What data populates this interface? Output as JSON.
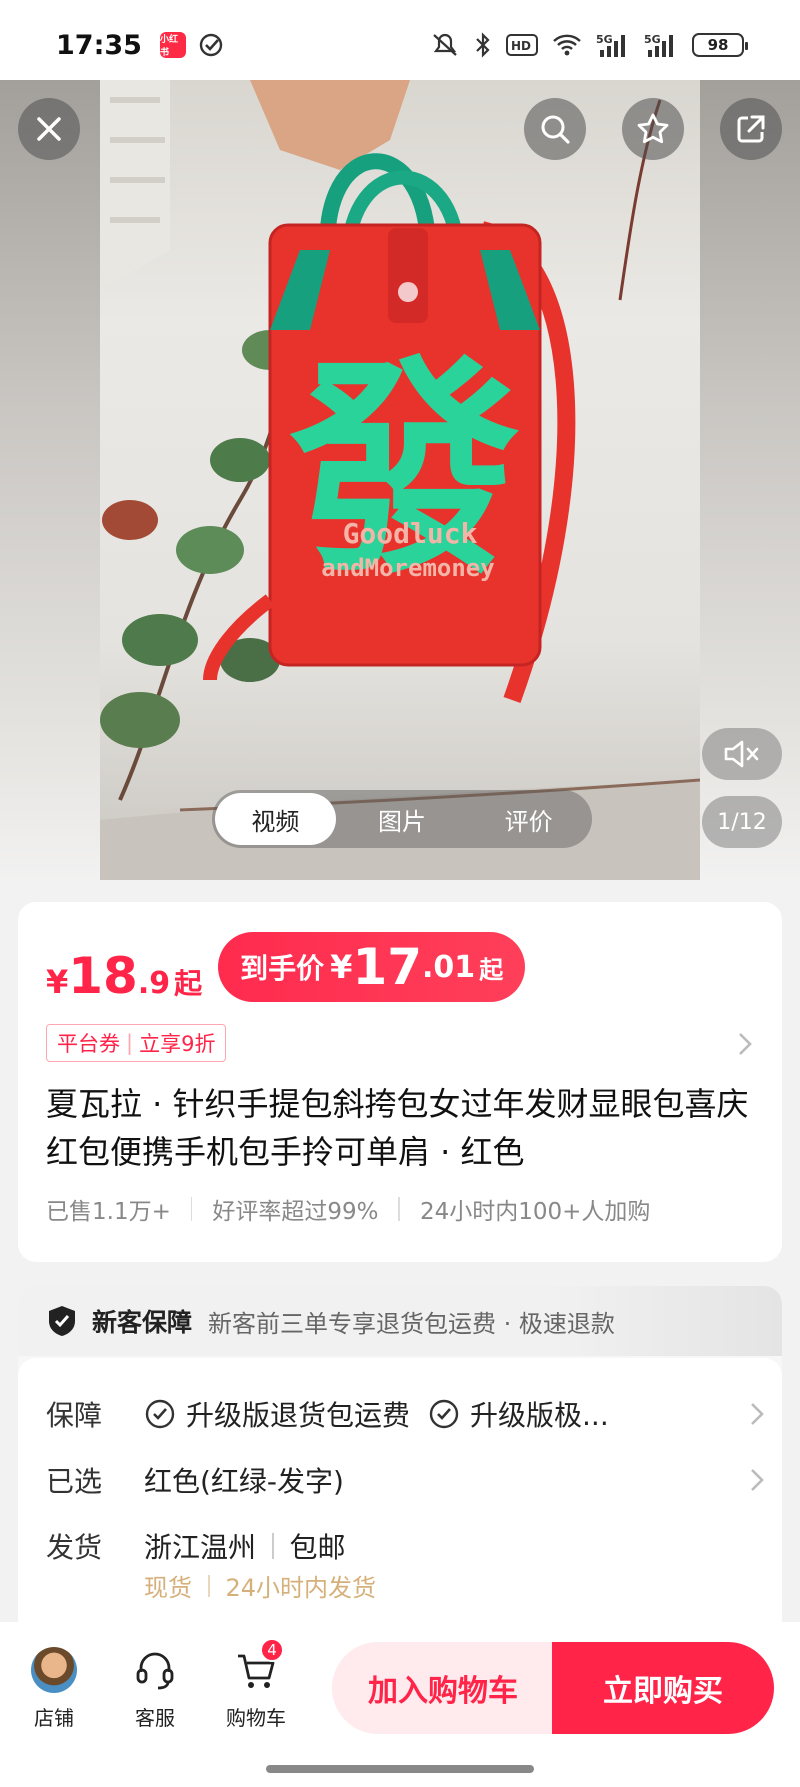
{
  "status_bar": {
    "time": "17:35",
    "app_badge": "小红书",
    "battery": "98",
    "icons": [
      "mute-icon",
      "bluetooth-icon",
      "hd-icon",
      "wifi-icon",
      "signal-5g-icon",
      "signal-5g-icon"
    ]
  },
  "media": {
    "bag_text_line1": "Goodluck",
    "bag_text_line2": "andMoremoney",
    "bag_char": "發",
    "tabs": [
      {
        "label": "视频",
        "active": true
      },
      {
        "label": "图片",
        "active": false
      },
      {
        "label": "评价",
        "active": false
      }
    ],
    "pager": "1/12"
  },
  "price": {
    "currency": "¥",
    "integer": "18",
    "decimal": ".9",
    "suffix": "起",
    "final_label": "到手价",
    "final_currency": "¥",
    "final_integer": "17",
    "final_decimal": ".01",
    "final_suffix": "起",
    "coupon_left": "平台券",
    "coupon_sep": "|",
    "coupon_right": "立享9折"
  },
  "product": {
    "title": "夏瓦拉 · 针织手提包斜挎包女过年发财显眼包喜庆红包便携手机包手拎可单肩 · 红色",
    "stats": [
      "已售1.1万+",
      "好评率超过99%",
      "24小时内100+人加购"
    ]
  },
  "guarantee": {
    "title": "新客保障",
    "desc": "新客前三单专享退货包运费 · 极速退款",
    "rows": {
      "protection_key": "保障",
      "protection_items": [
        "升级版退货包运费",
        "升级版极..."
      ],
      "selected_key": "已选",
      "selected_value": "红色(红绿-发字)",
      "ship_key": "发货",
      "ship_from": "浙江温州",
      "ship_fee": "包邮",
      "stock": "现货",
      "ship_time": "24小时内发货"
    }
  },
  "bottom_bar": {
    "store": "店铺",
    "service": "客服",
    "cart": "购物车",
    "cart_count": "4",
    "add_to_cart": "加入购物车",
    "buy_now": "立即购买"
  },
  "colors": {
    "accent": "#ff2448",
    "gold": "#d6b07a",
    "bag_red": "#e8322c",
    "bag_green": "#2ad39a"
  }
}
